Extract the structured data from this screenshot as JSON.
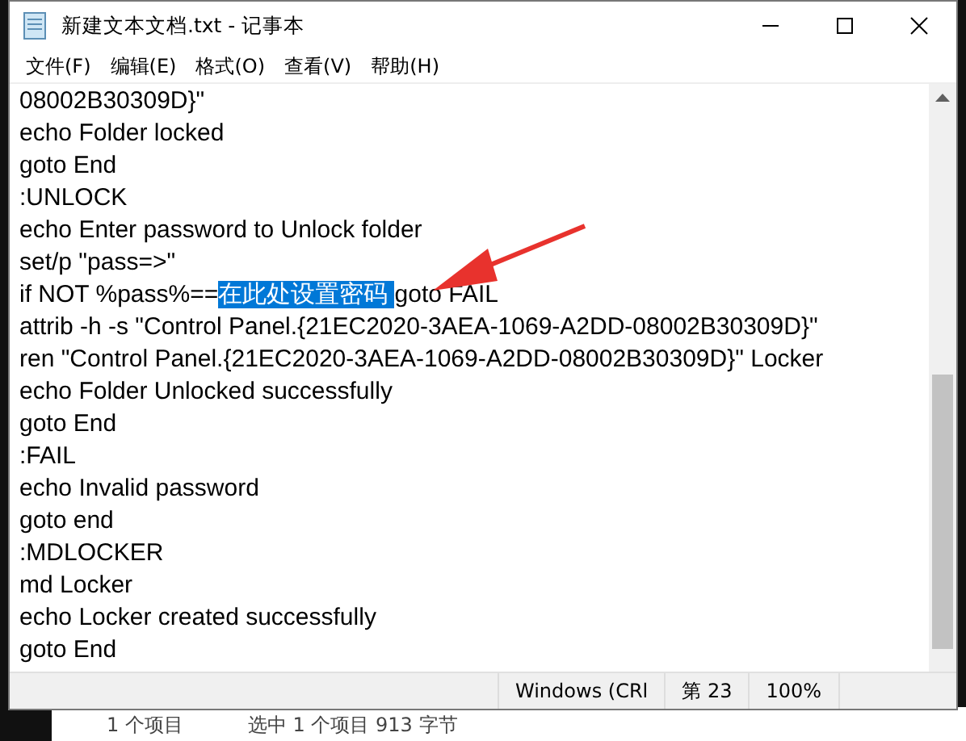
{
  "window": {
    "title": "新建文本文档.txt - 记事本"
  },
  "menu": [
    "文件(F)",
    "编辑(E)",
    "格式(O)",
    "查看(V)",
    "帮助(H)"
  ],
  "lines": [
    [
      {
        "text": "08002B30309D}\"",
        "selected": false
      }
    ],
    [
      {
        "text": "echo Folder locked",
        "selected": false
      }
    ],
    [
      {
        "text": "goto End",
        "selected": false
      }
    ],
    [
      {
        "text": ":UNLOCK",
        "selected": false
      }
    ],
    [
      {
        "text": "echo Enter password to Unlock folder",
        "selected": false
      }
    ],
    [
      {
        "text": "set/p \"pass=>\"",
        "selected": false
      }
    ],
    [
      {
        "text": "if NOT %pass%==",
        "selected": false
      },
      {
        "text": "在此处设置密码 ",
        "selected": true
      },
      {
        "text": "goto FAIL",
        "selected": false
      }
    ],
    [
      {
        "text": "attrib -h -s \"Control Panel.{21EC2020-3AEA-1069-A2DD-08002B30309D}\"",
        "selected": false
      }
    ],
    [
      {
        "text": "ren \"Control Panel.{21EC2020-3AEA-1069-A2DD-08002B30309D}\" Locker",
        "selected": false
      }
    ],
    [
      {
        "text": "echo Folder Unlocked successfully",
        "selected": false
      }
    ],
    [
      {
        "text": "goto End",
        "selected": false
      }
    ],
    [
      {
        "text": ":FAIL",
        "selected": false
      }
    ],
    [
      {
        "text": "echo Invalid password",
        "selected": false
      }
    ],
    [
      {
        "text": "goto end",
        "selected": false
      }
    ],
    [
      {
        "text": ":MDLOCKER",
        "selected": false
      }
    ],
    [
      {
        "text": "md Locker",
        "selected": false
      }
    ],
    [
      {
        "text": "echo Locker created successfully",
        "selected": false
      }
    ],
    [
      {
        "text": "goto End",
        "selected": false
      }
    ]
  ],
  "status_bar": [
    "Windows (CRl",
    "第 23",
    "100%"
  ],
  "explorer_status": [
    "1 个项目",
    "选中 1 个项目  913 字节"
  ]
}
